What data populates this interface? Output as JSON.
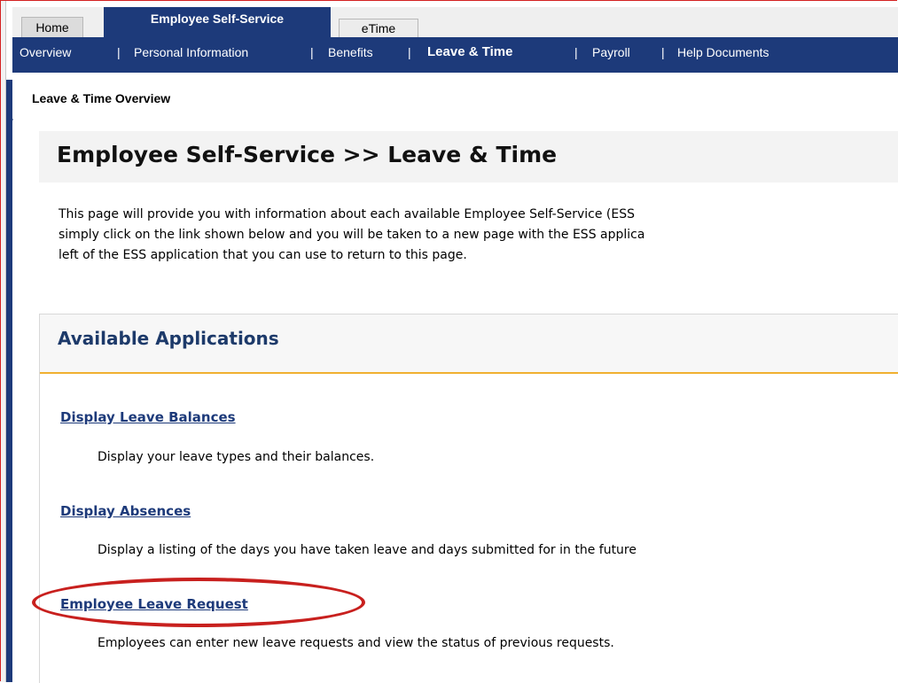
{
  "tabs": {
    "home": "Home",
    "ess": "Employee Self-Service",
    "etime": "eTime"
  },
  "subnav": {
    "overview": "Overview",
    "personal": "Personal Information",
    "benefits": "Benefits",
    "leave_time": "Leave & Time",
    "payroll": "Payroll",
    "help": "Help Documents",
    "separator": "|"
  },
  "breadcrumb": "Leave & Time Overview",
  "page_title": "Employee Self-Service >> Leave & Time",
  "intro": {
    "line1": "This page will provide you with information about each available Employee Self-Service (ESS",
    "line2": "simply click on the link shown below and you will be taken to a new page with the ESS applica",
    "line3": "left of the ESS application that you can use to return to this page."
  },
  "apps": {
    "title": "Available Applications",
    "items": [
      {
        "label": "Display Leave Balances",
        "desc": "Display your leave types and their balances."
      },
      {
        "label": "Display Absences",
        "desc": "Display a listing of the days you have taken leave and days submitted for in the future"
      },
      {
        "label": "Employee Leave Request",
        "desc": "Employees can enter new leave requests and view the status of previous requests."
      }
    ]
  },
  "colors": {
    "nav_blue": "#1d3a7a",
    "accent_gold": "#f0b030",
    "highlight_red": "#c8201e"
  }
}
